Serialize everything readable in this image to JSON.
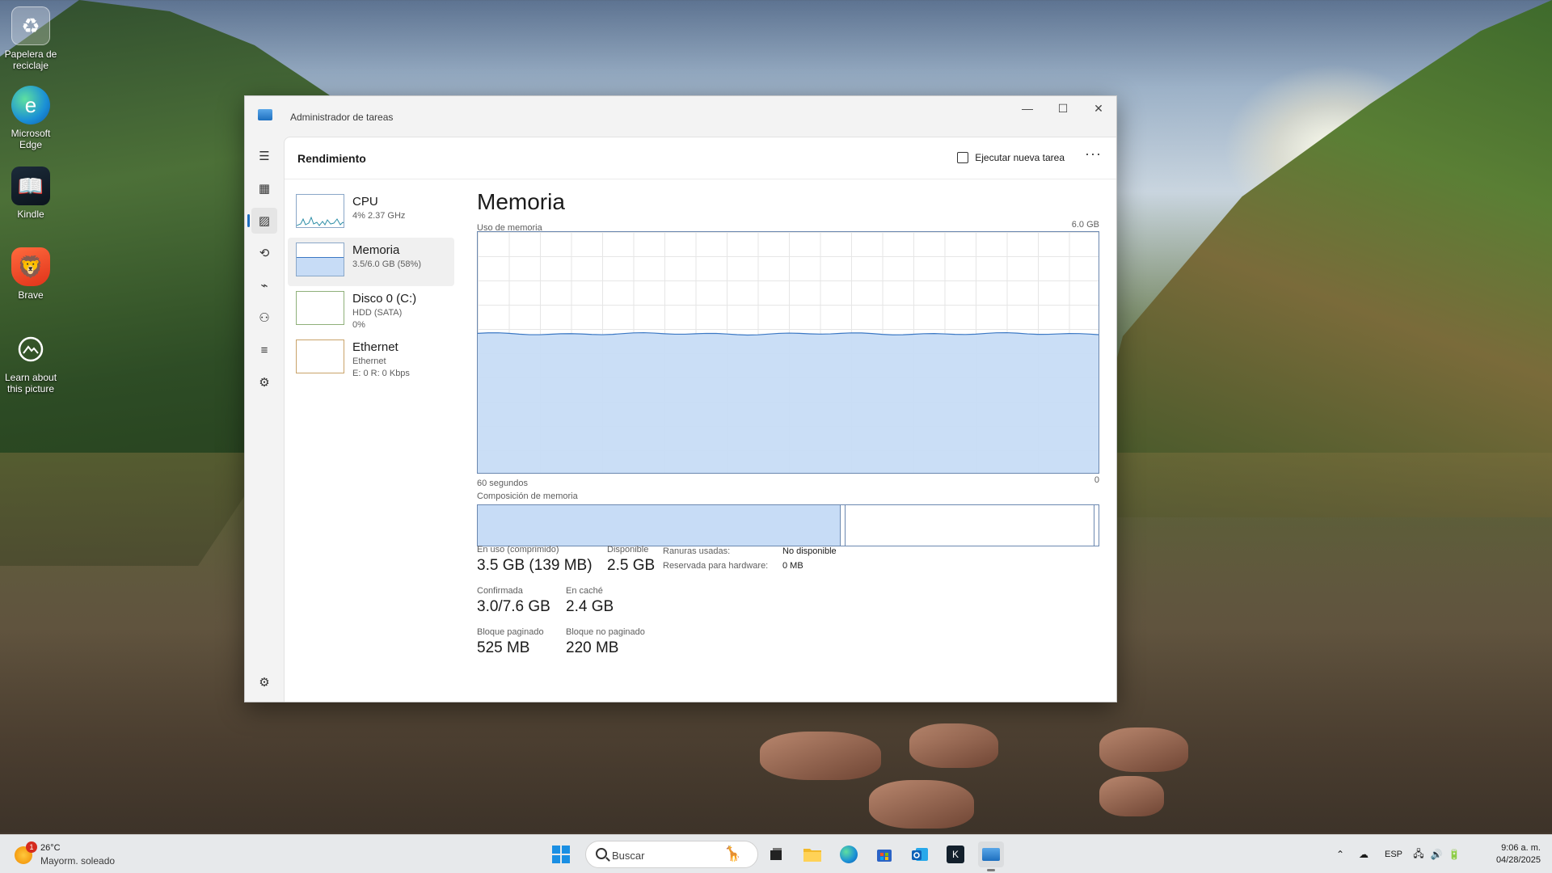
{
  "desktop": {
    "icons": [
      {
        "label": "Papelera de reciclaje",
        "icon": "recycle-bin-icon"
      },
      {
        "label": "Microsoft Edge",
        "icon": "edge-icon"
      },
      {
        "label": "Kindle",
        "icon": "kindle-icon"
      },
      {
        "label": "Brave",
        "icon": "brave-icon"
      },
      {
        "label": "Learn about this picture",
        "icon": "camera-icon"
      }
    ]
  },
  "window": {
    "title": "Administrador de tareas",
    "page_title": "Rendimiento",
    "run_task_label": "Ejecutar nueva tarea",
    "more_label": "···"
  },
  "perf_items": [
    {
      "name": "CPU",
      "sub1": "4% 2.37 GHz",
      "sub2": ""
    },
    {
      "name": "Memoria",
      "sub1": "3.5/6.0 GB (58%)",
      "sub2": ""
    },
    {
      "name": "Disco 0 (C:)",
      "sub1": "HDD (SATA)",
      "sub2": "0%"
    },
    {
      "name": "Ethernet",
      "sub1": "Ethernet",
      "sub2": "E: 0 R: 0 Kbps"
    }
  ],
  "memory": {
    "title": "Memoria",
    "usage_label": "Uso de memoria",
    "max_label": "6.0 GB",
    "time_label": "60 segundos",
    "zero_label": "0",
    "composition_label": "Composición de memoria",
    "usage_fraction": 0.58,
    "composition": {
      "in_use_fraction": 0.585,
      "modified_fraction": 0.008,
      "standby_fraction": 0.4
    },
    "stats": {
      "in_use_label": "En uso (comprimido)",
      "in_use_value": "3.5 GB (139 MB)",
      "available_label": "Disponible",
      "available_value": "2.5 GB",
      "committed_label": "Confirmada",
      "committed_value": "3.0/7.6 GB",
      "cached_label": "En caché",
      "cached_value": "2.4 GB",
      "paged_label": "Bloque paginado",
      "paged_value": "525 MB",
      "nonpaged_label": "Bloque no paginado",
      "nonpaged_value": "220 MB",
      "slots_label": "Ranuras usadas:",
      "slots_value": "No disponible",
      "reserved_label": "Reservada para hardware:",
      "reserved_value": "0 MB"
    }
  },
  "taskbar": {
    "weather_temp": "26°C",
    "weather_desc": "Mayorm. soleado",
    "weather_badge": "1",
    "search_placeholder": "Buscar",
    "language": "ESP",
    "time": "9:06 a. m.",
    "date": "04/28/2025"
  },
  "colors": {
    "accent": "#1f6fbf",
    "graph_fill": "#c7dcf6",
    "graph_line": "#3b78c4"
  }
}
